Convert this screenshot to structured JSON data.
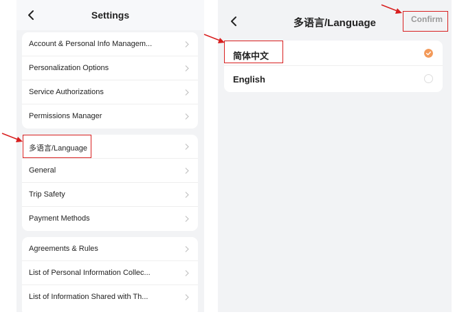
{
  "settings": {
    "title": "Settings",
    "groups": [
      {
        "items": [
          {
            "label": "Account & Personal Info Managem..."
          },
          {
            "label": "Personalization Options"
          },
          {
            "label": "Service Authorizations"
          },
          {
            "label": "Permissions Manager"
          }
        ]
      },
      {
        "items": [
          {
            "label": "多语言/Language"
          },
          {
            "label": "General"
          },
          {
            "label": "Trip Safety"
          },
          {
            "label": "Payment Methods"
          }
        ]
      },
      {
        "items": [
          {
            "label": "Agreements & Rules"
          },
          {
            "label": "List of Personal Information Collec..."
          },
          {
            "label": "List of Information Shared with Th..."
          }
        ]
      }
    ]
  },
  "language": {
    "title": "多语言/Language",
    "confirm_label": "Confirm",
    "options": [
      {
        "label": "简体中文",
        "selected": true
      },
      {
        "label": "English",
        "selected": false
      }
    ]
  },
  "colors": {
    "accent": "#f39a5a",
    "annotation": "#d81e1e",
    "background": "#f2f3f5"
  },
  "icons": [
    "back-arrow-icon",
    "chevron-right-icon",
    "radio-checked-icon",
    "radio-unchecked-icon",
    "annotation-arrow-icon"
  ]
}
